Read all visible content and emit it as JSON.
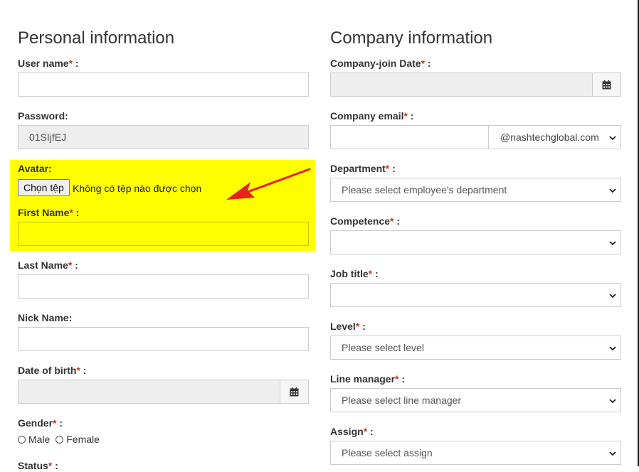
{
  "personal": {
    "title": "Personal information",
    "username": {
      "label": "User name",
      "value": ""
    },
    "password": {
      "label": "Password:",
      "value": "01SIjfEJ"
    },
    "avatar": {
      "label": "Avatar:",
      "button": "Chọn tệp",
      "status": "Không có tệp nào được chọn"
    },
    "first_name": {
      "label": "First Name",
      "value": ""
    },
    "last_name": {
      "label": "Last Name",
      "value": ""
    },
    "nick_name": {
      "label": "Nick Name:",
      "value": ""
    },
    "dob": {
      "label": "Date of birth",
      "value": ""
    },
    "gender": {
      "label": "Gender",
      "options": [
        "Male",
        "Female"
      ]
    },
    "status": {
      "label": "Status"
    }
  },
  "company": {
    "title": "Company information",
    "join_date": {
      "label": "Company-join Date",
      "value": ""
    },
    "email": {
      "label": "Company email",
      "value": "",
      "domain": "@nashtechglobal.com"
    },
    "department": {
      "label": "Department",
      "value": "Please select employee's department"
    },
    "competence": {
      "label": "Competence",
      "value": ""
    },
    "job_title": {
      "label": "Job title",
      "value": ""
    },
    "level": {
      "label": "Level",
      "value": "Please select level"
    },
    "line_manager": {
      "label": "Line manager",
      "value": "Please select line manager"
    },
    "assign": {
      "label": "Assign",
      "value": "Please select assign"
    }
  },
  "common": {
    "required_mark": "*",
    "colon": " :"
  },
  "colors": {
    "highlight": "#ffff00",
    "arrow": "#e8201e",
    "required": "#c0392b"
  },
  "icons": {
    "calendar": "calendar-icon",
    "select": "chevron-down-icon",
    "annotation": "red-arrow-annotation"
  }
}
